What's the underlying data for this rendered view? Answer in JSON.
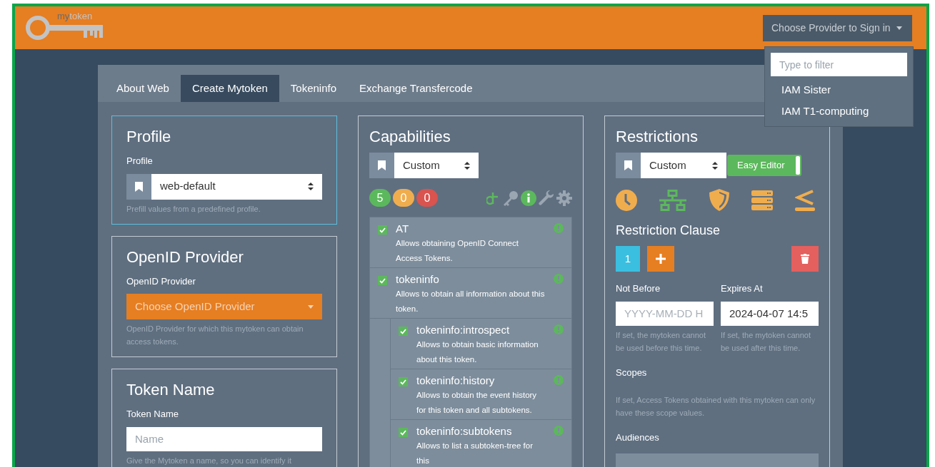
{
  "logo": {
    "prefix": "my",
    "suffix": "token"
  },
  "signin": {
    "label": "Choose Provider to Sign in",
    "expanded": true,
    "filter_placeholder": "Type to filter",
    "options": [
      "IAM Sister",
      "IAM T1-computing"
    ]
  },
  "tabs": [
    {
      "label": "About Web",
      "selected": false
    },
    {
      "label": "Create Mytoken",
      "selected": true
    },
    {
      "label": "Tokeninfo",
      "selected": false
    },
    {
      "label": "Exchange Transfercode",
      "selected": false
    }
  ],
  "profile": {
    "title": "Profile",
    "label": "Profile",
    "value": "web-default",
    "help": "Prefill values from a predefined profile."
  },
  "openid": {
    "title": "OpenID Provider",
    "label": "OpenID Provider",
    "value": "Choose OpenID Provider",
    "help": "OpenID Provider for which this mytoken can obtain access tokens."
  },
  "token_name": {
    "title": "Token Name",
    "label": "Token Name",
    "placeholder": "Name",
    "help": "Give the Mytoken a name, so you can identify it"
  },
  "capabilities": {
    "title": "Capabilities",
    "preset": "Custom",
    "counts": [
      {
        "value": "5",
        "color": "#5cb85c"
      },
      {
        "value": "0",
        "color": "#f0ad4e"
      },
      {
        "value": "0",
        "color": "#d9534f"
      }
    ],
    "items": [
      {
        "name": "AT",
        "description": "Allows obtaining OpenID Connect Access Tokens.",
        "checked": true
      },
      {
        "name": "tokeninfo",
        "description": "Allows to obtain all information about this token.",
        "checked": true,
        "children": [
          {
            "name": "tokeninfo:introspect",
            "description": "Allows to obtain basic information about this token.",
            "checked": true
          },
          {
            "name": "tokeninfo:history",
            "description": "Allows to obtain the event history for this token and all subtokens.",
            "checked": true
          },
          {
            "name": "tokeninfo:subtokens",
            "description": "Allows to list a subtoken-tree for this",
            "checked": true
          }
        ]
      }
    ]
  },
  "restrictions": {
    "title": "Restrictions",
    "preset": "Custom",
    "easy_editor": {
      "label": "Easy Editor",
      "on": true
    },
    "clause_title": "Restriction Clause",
    "clauses": [
      {
        "label": "1",
        "selected": true
      }
    ],
    "not_before": {
      "label": "Not Before",
      "placeholder": "YYYY-MM-DD H",
      "help": "If set, the mytoken cannot be used before this time."
    },
    "expires_at": {
      "label": "Expires At",
      "value": "2024-04-07 14:5",
      "help": "If set, the mytoken cannot be used after this time."
    },
    "scopes": {
      "label": "Scopes",
      "help": "If set, Access Tokens obtained with this mytoken can only have these scope values."
    },
    "audiences": {
      "label": "Audiences"
    }
  }
}
